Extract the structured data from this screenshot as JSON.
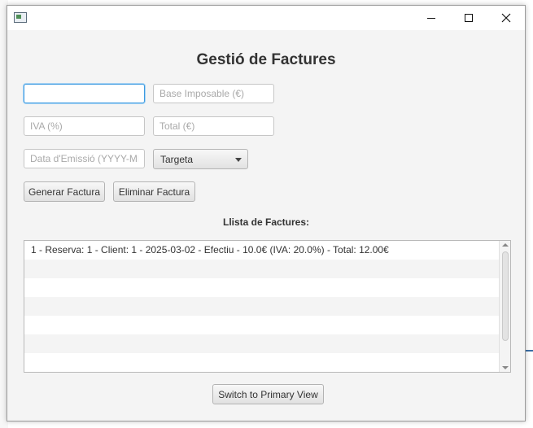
{
  "window": {
    "title": ""
  },
  "form": {
    "title": "Gestió de Factures",
    "id_field": {
      "value": "",
      "placeholder": ""
    },
    "base_field": {
      "value": "",
      "placeholder": "Base Imposable (€)"
    },
    "iva_field": {
      "value": "",
      "placeholder": "IVA (%)"
    },
    "total_field": {
      "value": "",
      "placeholder": "Total (€)"
    },
    "date_field": {
      "value": "",
      "placeholder": "Data d'Emissió (YYYY-MM-DD)"
    },
    "payment_combo": {
      "selected": "Targeta"
    },
    "generate_button": "Generar Factura",
    "delete_button": "Eliminar Factura"
  },
  "list": {
    "label": "Llista de Factures:",
    "items": [
      "1 - Reserva: 1 - Client: 1 - 2025-03-02 - Efectiu - 10.0€ (IVA: 20.0%) - Total: 12.00€"
    ]
  },
  "footer": {
    "switch_button": "Switch to Primary View"
  },
  "colors": {
    "focus_border": "#3c9ae0",
    "window_bg": "#f4f4f4"
  }
}
